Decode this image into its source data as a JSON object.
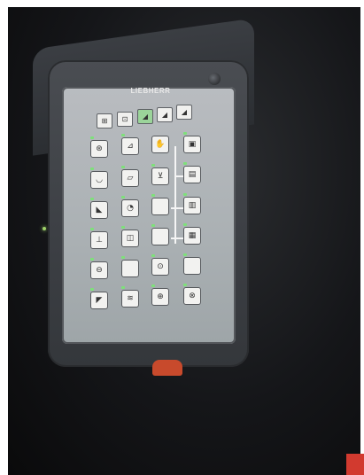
{
  "device": {
    "brand": "LIEBHERR",
    "led_color": "#7ee07a",
    "emergency_stop_color": "#c84a2c"
  },
  "top_row": [
    {
      "icon": "ground-drive-icon",
      "glyph": "⊞",
      "lit": false
    },
    {
      "icon": "lift-icon",
      "glyph": "⊡",
      "lit": false
    },
    {
      "icon": "ramp-mode-1-icon",
      "glyph": "◢",
      "lit": true
    },
    {
      "icon": "ramp-mode-2-icon",
      "glyph": "◢",
      "lit": false
    },
    {
      "icon": "ramp-mode-3-icon",
      "glyph": "◢",
      "lit": false
    }
  ],
  "keys": [
    {
      "icon": "steering-wheel-icon",
      "glyph": "⊛"
    },
    {
      "icon": "tilt-icon",
      "glyph": "⊿"
    },
    {
      "icon": "stop-hand-icon",
      "glyph": "✋"
    },
    {
      "icon": "hydraulic-icon",
      "glyph": "▣"
    },
    {
      "icon": "bucket-icon",
      "glyph": "◡"
    },
    {
      "icon": "float-icon",
      "glyph": "▱"
    },
    {
      "icon": "shake-icon",
      "glyph": "⊻"
    },
    {
      "icon": "machine-1-icon",
      "glyph": "▤"
    },
    {
      "icon": "work-light-front-icon",
      "glyph": "◣"
    },
    {
      "icon": "rotating-beacon-icon",
      "glyph": "◔"
    },
    {
      "icon": "blank-key-1-icon",
      "glyph": ""
    },
    {
      "icon": "machine-2-icon",
      "glyph": "▥"
    },
    {
      "icon": "crane-icon",
      "glyph": "⊥"
    },
    {
      "icon": "fan-icon",
      "glyph": "◫"
    },
    {
      "icon": "blank-key-2-icon",
      "glyph": ""
    },
    {
      "icon": "machine-3-icon",
      "glyph": "▦"
    },
    {
      "icon": "interlock-icon",
      "glyph": "⊖"
    },
    {
      "icon": "blank-key-3-icon",
      "glyph": ""
    },
    {
      "icon": "engine-icon",
      "glyph": "⊙"
    },
    {
      "icon": "blank-key-4-icon",
      "glyph": ""
    },
    {
      "icon": "wiper-icon",
      "glyph": "◤"
    },
    {
      "icon": "washer-icon",
      "glyph": "≋"
    },
    {
      "icon": "air-filter-icon",
      "glyph": "⊕"
    },
    {
      "icon": "engine-2-icon",
      "glyph": "⊗"
    }
  ]
}
